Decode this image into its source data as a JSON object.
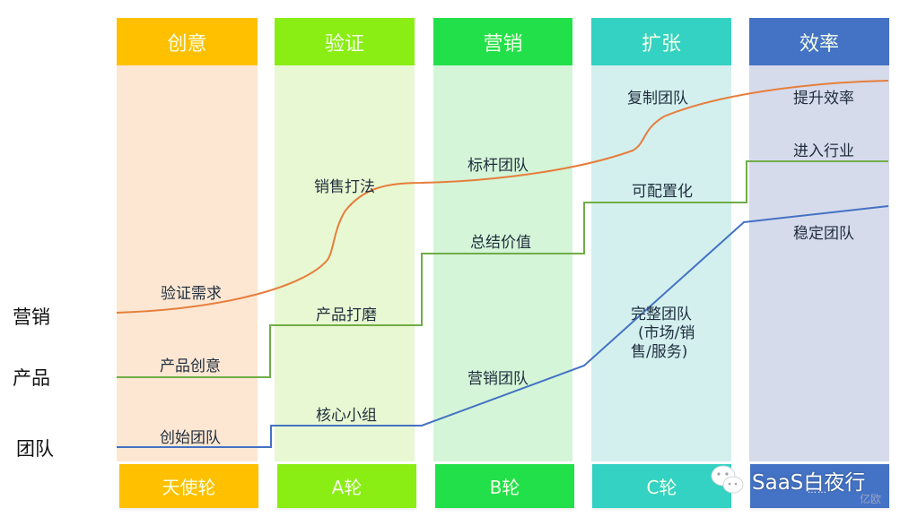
{
  "stages": [
    {
      "title": "创意",
      "round": "天使轮",
      "head_color": "#FFC000",
      "body_color": "#FDE7D2",
      "foot_color": "#FFC000"
    },
    {
      "title": "验证",
      "round": "A轮",
      "head_color": "#8AEE14",
      "body_color": "#E8F8D2",
      "foot_color": "#8AEE14"
    },
    {
      "title": "营销",
      "round": "B轮",
      "head_color": "#22E04A",
      "body_color": "#D4F5D8",
      "foot_color": "#22E04A"
    },
    {
      "title": "扩张",
      "round": "C轮",
      "head_color": "#33D2C2",
      "body_color": "#D3F0EF",
      "foot_color": "#33D2C2"
    },
    {
      "title": "效率",
      "round": "……",
      "head_color": "#4472C4",
      "body_color": "#D6DBEC",
      "foot_color": "#4472C4"
    }
  ],
  "rows": [
    {
      "label": "营销",
      "line_color": "#E67E3C"
    },
    {
      "label": "产品",
      "line_color": "#70AD47"
    },
    {
      "label": "团队",
      "line_color": "#4472C4"
    }
  ],
  "milestones": {
    "marketing": [
      "验证需求",
      "销售打法",
      "标杆团队",
      "复制团队",
      "提升效率"
    ],
    "product": [
      "产品创意",
      "产品打磨",
      "总结价值",
      "可配置化",
      "进入行业"
    ],
    "team": [
      "创始团队",
      "核心小组",
      "营销团队",
      "完整团队\n(市场/销\n售/服务)",
      "稳定团队"
    ]
  },
  "watermark": {
    "text": "SaaS白夜行",
    "icon": "wechat-icon",
    "corner_text": "亿欧"
  }
}
